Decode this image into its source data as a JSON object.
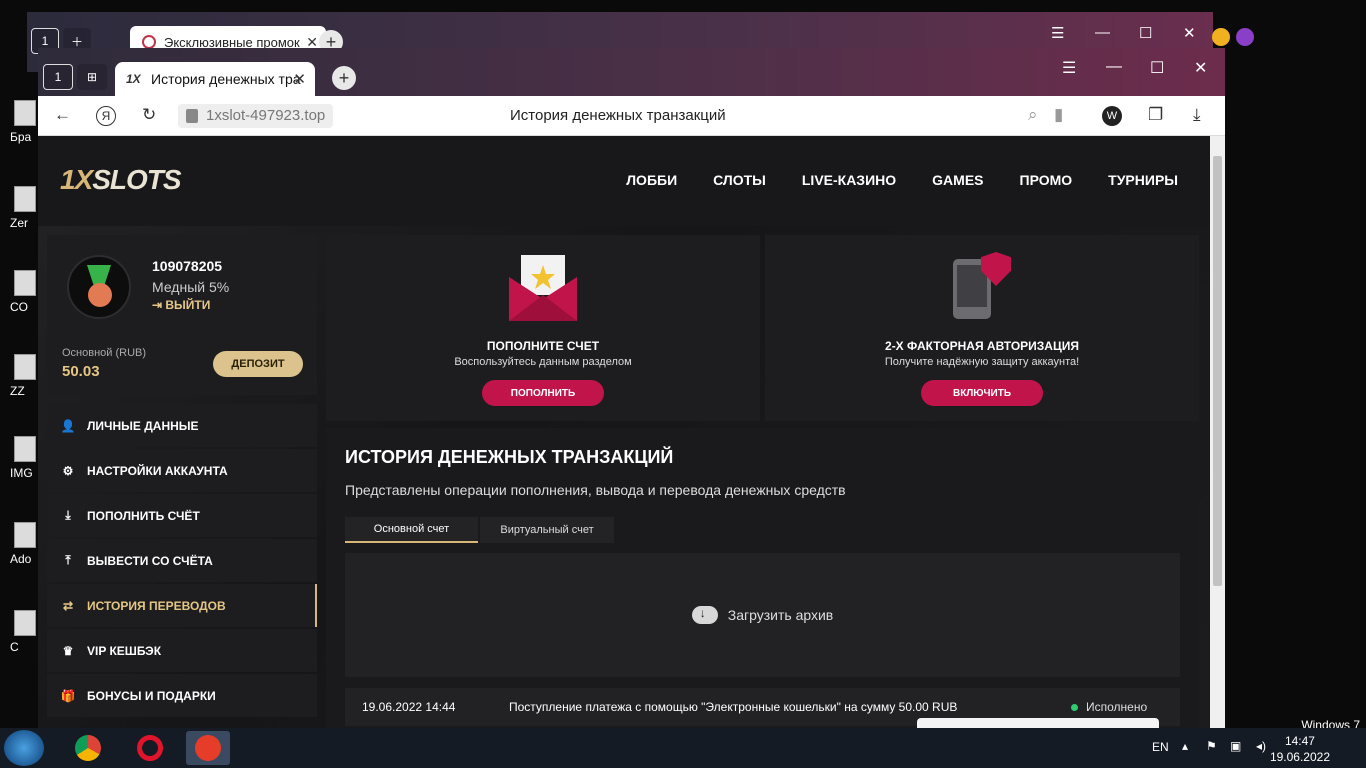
{
  "desktop": {
    "icons": [
      {
        "label": "Бра"
      },
      {
        "label": "Zer"
      },
      {
        "label": "CO"
      },
      {
        "label": "ZZ"
      },
      {
        "label": "IMG"
      },
      {
        "label": "Ado"
      },
      {
        "label": "C"
      }
    ],
    "os_label": "Windows 7"
  },
  "back_window": {
    "tab_title": "Эксклюзивные промок",
    "tab_count": "1"
  },
  "browser": {
    "tab_count": "1",
    "tab_title": "История денежных тра",
    "tab_favicon": "1X",
    "url": "1xslot-497923.top",
    "page_title": "История денежных транзакций",
    "yandex_label": "Я"
  },
  "site": {
    "logo_prefix": "1X",
    "logo_suffix": "SLOTS",
    "nav": [
      "ЛОББИ",
      "СЛОТЫ",
      "LIVE-КАЗИНО",
      "GAMES",
      "ПРОМО",
      "ТУРНИРЫ"
    ]
  },
  "profile": {
    "id": "109078205",
    "level": "Медный 5%",
    "logout": "ВЫЙТИ",
    "balance_label": "Основной (RUB)",
    "balance_value": "50.03",
    "deposit_btn": "ДЕПОЗИТ"
  },
  "menu": [
    {
      "label": "ЛИЧНЫЕ ДАННЫЕ",
      "icon": "user-plus-icon",
      "glyph": "👤"
    },
    {
      "label": "НАСТРОЙКИ АККАУНТА",
      "icon": "gears-icon",
      "glyph": "⚙"
    },
    {
      "label": "ПОПОЛНИТЬ СЧЁТ",
      "icon": "download-icon",
      "glyph": "⤓"
    },
    {
      "label": "ВЫВЕСТИ СО СЧЁТА",
      "icon": "upload-icon",
      "glyph": "⤒"
    },
    {
      "label": "ИСТОРИЯ ПЕРЕВОДОВ",
      "icon": "transfer-icon",
      "glyph": "⇄"
    },
    {
      "label": "VIP КЕШБЭК",
      "icon": "crown-icon",
      "glyph": "♛"
    },
    {
      "label": "БОНУСЫ И ПОДАРКИ",
      "icon": "gift-icon",
      "glyph": "🎁"
    }
  ],
  "cards": {
    "deposit": {
      "title": "ПОПОЛНИТЕ СЧЕТ",
      "subtitle": "Воспользуйтесь данным разделом",
      "button": "ПОПОЛНИТЬ"
    },
    "twofa": {
      "title": "2-Х ФАКТОРНАЯ АВТОРИЗАЦИЯ",
      "subtitle": "Получите надёжную защиту аккаунта!",
      "button": "ВКЛЮЧИТЬ"
    }
  },
  "history": {
    "title": "ИСТОРИЯ ДЕНЕЖНЫХ ТРАНЗАКЦИЙ",
    "subtitle": "Представлены операции пополнения, вывода и перевода денежных средств",
    "tab_main": "Основной счет",
    "tab_virtual": "Виртуальный счет",
    "archive_label": "Загрузить архив",
    "rows": [
      {
        "date": "19.06.2022 14:44",
        "description": "Поступление платежа с помощью \"Электронные кошельки\" на сумму 50.00 RUB",
        "status": "Исполнено"
      }
    ]
  },
  "taskbar": {
    "lang": "EN",
    "time": "14:47",
    "date": "19.06.2022"
  },
  "colors": {
    "accent_gold": "#d7b678",
    "accent_red": "#c1144a",
    "status_green": "#2ecc71"
  }
}
